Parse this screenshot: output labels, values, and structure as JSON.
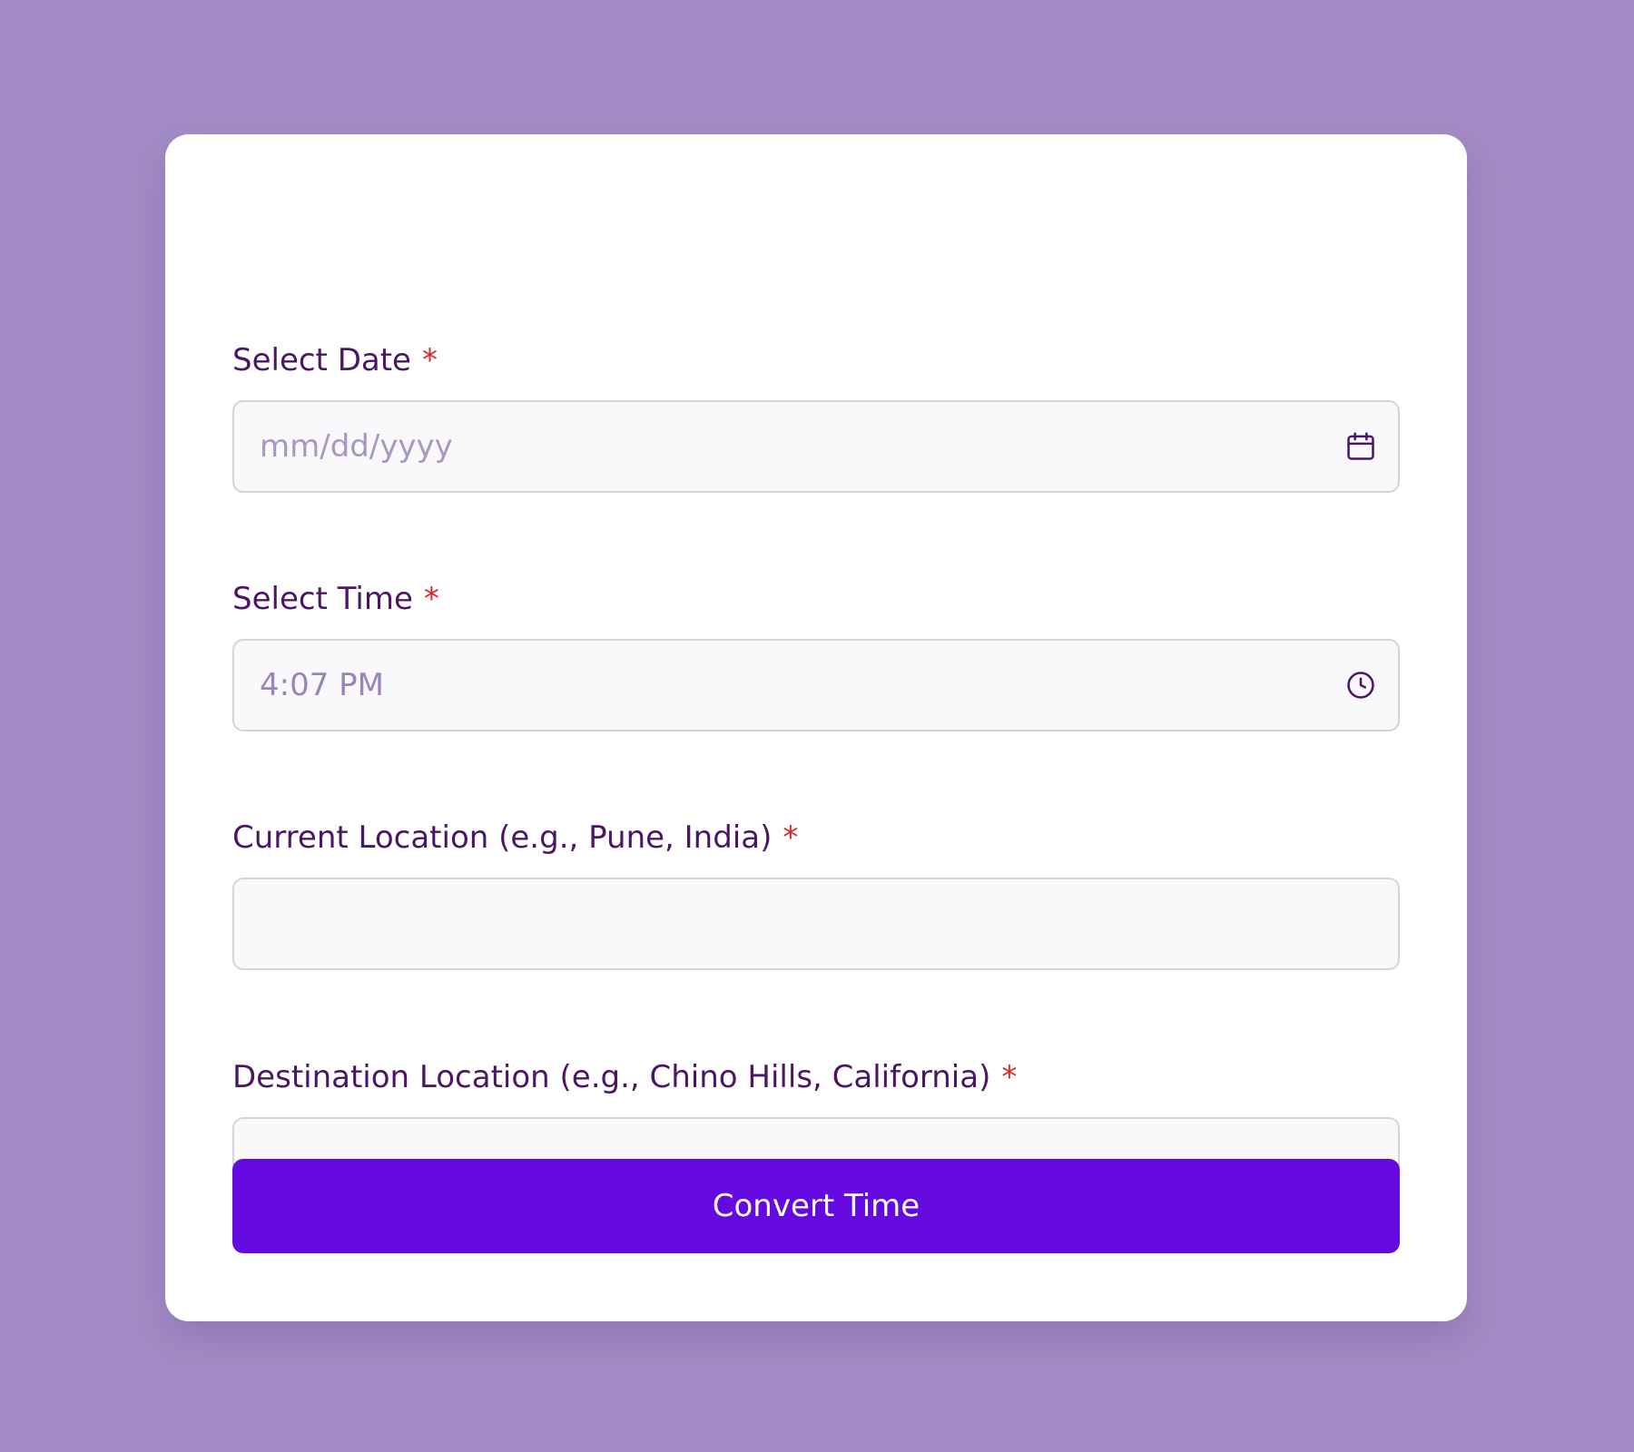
{
  "form": {
    "date": {
      "label": "Select Date",
      "required_mark": "*",
      "placeholder": "mm/dd/yyyy",
      "value": "",
      "icon": "calendar-icon"
    },
    "time": {
      "label": "Select Time",
      "required_mark": "*",
      "placeholder": "",
      "value": "4:07 PM",
      "icon": "clock-icon"
    },
    "current_location": {
      "label": "Current Location (e.g., Pune, India)",
      "required_mark": "*",
      "placeholder": "",
      "value": ""
    },
    "destination_location": {
      "label": "Destination Location (e.g., Chino Hills, California)",
      "required_mark": "*",
      "placeholder": "",
      "value": ""
    },
    "submit_label": "Convert Time"
  },
  "colors": {
    "background": "#a38cc5",
    "card": "#ffffff",
    "label": "#4b1666",
    "required": "#d22b2b",
    "input_bg": "#f9f9fb",
    "input_border": "#d4d4da",
    "button": "#640ae0",
    "button_text": "#ffffff"
  }
}
